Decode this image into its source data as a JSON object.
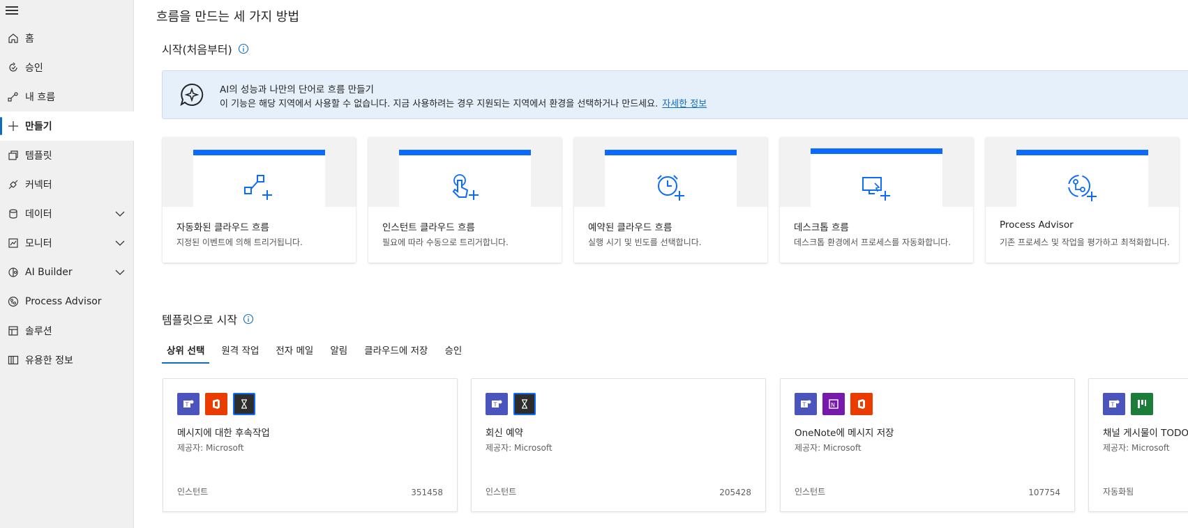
{
  "sidebar": {
    "items": [
      {
        "label": "홈",
        "icon": "home-icon"
      },
      {
        "label": "승인",
        "icon": "approval-icon"
      },
      {
        "label": "내 흐름",
        "icon": "flow-icon"
      },
      {
        "label": "만들기",
        "icon": "plus-icon"
      },
      {
        "label": "템플릿",
        "icon": "template-icon"
      },
      {
        "label": "커넥터",
        "icon": "connector-icon"
      },
      {
        "label": "데이터",
        "icon": "database-icon"
      },
      {
        "label": "모니터",
        "icon": "monitor-icon"
      },
      {
        "label": "AI Builder",
        "icon": "ai-builder-icon"
      },
      {
        "label": "Process Advisor",
        "icon": "process-advisor-icon"
      },
      {
        "label": "솔루션",
        "icon": "solution-icon"
      },
      {
        "label": "유용한 정보",
        "icon": "book-icon"
      }
    ]
  },
  "main": {
    "page_title": "흐름을 만드는 세 가지 방법",
    "start_section": "시작(처음부터)",
    "banner": {
      "title": "AI의 성능과 나만의 단어로 흐름 만들기",
      "text": "이 기능은 해당 지역에서 사용할 수 없습니다. 지금 사용하려는 경우 지원되는 지역에서 환경을 선택하거나 만드세요.",
      "link": "자세한 정보"
    },
    "ways": [
      {
        "title": "자동화된 클라우드 흐름",
        "desc": "지정된 이벤트에 의해 트리거됩니다.",
        "icon": "automated-flow-icon"
      },
      {
        "title": "인스턴트 클라우드 흐름",
        "desc": "필요에 따라 수동으로 트리거합니다.",
        "icon": "instant-flow-icon"
      },
      {
        "title": "예약된 클라우드 흐름",
        "desc": "실행 시기 및 빈도를 선택합니다.",
        "icon": "scheduled-flow-icon"
      },
      {
        "title": "데스크톱 흐름",
        "desc": "데스크톱 환경에서 프로세스를 자동화합니다.",
        "icon": "desktop-flow-icon"
      },
      {
        "title": "Process Advisor",
        "desc": "기존 프로세스 및 작업을 평가하고 최적화합니다.",
        "icon": "process-advisor-icon"
      }
    ],
    "templates_section": "템플릿으로 시작",
    "tabs": [
      "상위 선택",
      "원격 작업",
      "전자 메일",
      "알림",
      "클라우드에 저장",
      "승인"
    ],
    "templates": [
      {
        "title": "메시지에 대한 후속작업",
        "provider": "제공자: Microsoft",
        "type": "인스턴트",
        "count": "351458",
        "apps": [
          "teams",
          "office",
          "timer"
        ]
      },
      {
        "title": "회신 예약",
        "provider": "제공자: Microsoft",
        "type": "인스턴트",
        "count": "205428",
        "apps": [
          "teams",
          "timer"
        ]
      },
      {
        "title": "OneNote에 메시지 저장",
        "provider": "제공자: Microsoft",
        "type": "인스턴트",
        "count": "107754",
        "apps": [
          "teams",
          "onenote",
          "office"
        ]
      },
      {
        "title": "채널 게시물이 TODO로",
        "provider": "제공자: Microsoft",
        "type": "자동화됨",
        "count": "",
        "apps": [
          "teams",
          "planner"
        ]
      }
    ]
  },
  "colors": {
    "accent": "#0f6cbd",
    "card_bar": "#0b6aff",
    "banner_bg": "#e6f0fb",
    "teams": "#4b53bc",
    "office": "#eb3c00",
    "onenote": "#7719aa",
    "planner": "#1b7d39",
    "timer": "#2d2d2d"
  }
}
